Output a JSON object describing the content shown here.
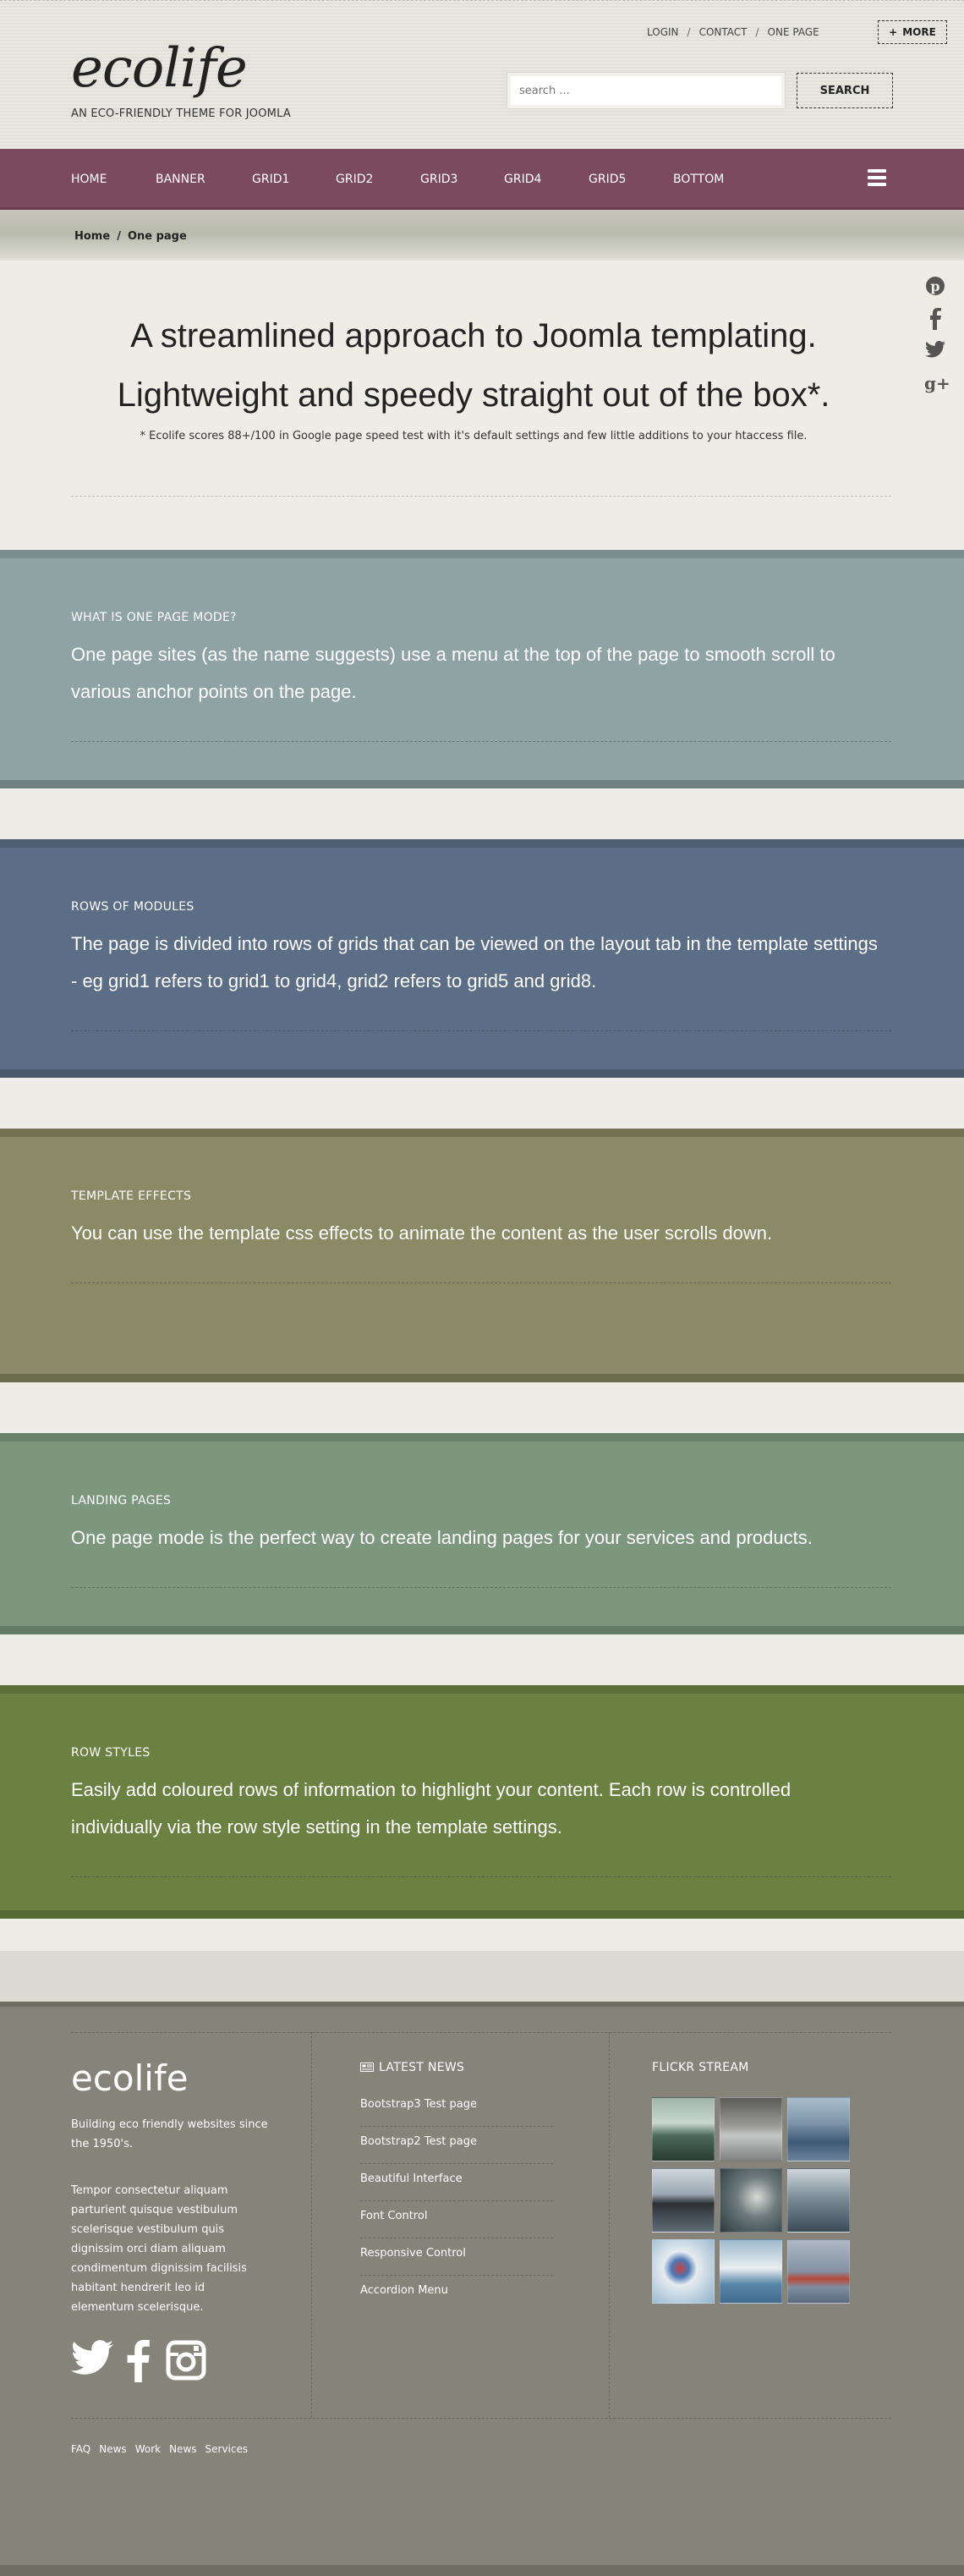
{
  "header": {
    "logo": "ecolife",
    "tagline": "AN ECO-FRIENDLY THEME FOR JOOMLA",
    "top_links": [
      "LOGIN",
      "CONTACT",
      "ONE PAGE"
    ],
    "more_label": "MORE",
    "search_placeholder": "search ...",
    "search_button": "SEARCH"
  },
  "nav": {
    "items": [
      "HOME",
      "BANNER",
      "GRID1",
      "GRID2",
      "GRID3",
      "GRID4",
      "GRID5",
      "BOTTOM"
    ],
    "color": "#7c4a5d"
  },
  "breadcrumb": [
    "Home",
    "/",
    "One page"
  ],
  "social_icons": [
    "pinterest-icon",
    "facebook-icon",
    "twitter-icon",
    "google-plus-icon"
  ],
  "hero": {
    "line1": "A streamlined approach to Joomla templating.",
    "line2": "Lightweight and speedy straight out of the box*.",
    "note": "* Ecolife scores 88+/100 in Google page speed test with it's default settings and few little additions to your htaccess file."
  },
  "rows": [
    {
      "kicker": "WHAT IS ONE PAGE MODE?",
      "line1": "One page sites (as the name suggests) use a menu at the top of the page to smooth scroll to",
      "line2": "various anchor points on the page.",
      "color": "#8fa3a5"
    },
    {
      "kicker": "ROWS OF MODULES",
      "line1": "The page is divided into rows of grids that can be viewed on the layout tab in the template settings",
      "line2": "- eg grid1 refers to grid1 to grid4, grid2 refers to grid5 and grid8.",
      "color": "#5c6e86"
    },
    {
      "kicker": "TEMPLATE EFFECTS",
      "line1": "You can use the template css effects to animate the content as the user scrolls down.",
      "line2": "",
      "color": "#8a8a66"
    },
    {
      "kicker": "LANDING PAGES",
      "line1": "One page mode is the perfect way to create landing pages for your services and products.",
      "line2": "",
      "color": "#7d977e"
    },
    {
      "kicker": "ROW STYLES",
      "line1": "Easily add coloured rows of information to highlight your content. Each row is controlled",
      "line2": "individually via the row style setting in the template settings.",
      "color": "#6b8142"
    }
  ],
  "footer": {
    "logo": "ecolife",
    "intro": [
      "Building eco friendly websites since",
      "the 1950's."
    ],
    "lorem": [
      "Tempor consectetur aliquam",
      "parturient quisque vestibulum",
      "scelerisque vestibulum quis",
      "dignissim orci diam aliquam",
      "condimentum dignissim facilisis",
      "habitant hendrerit leo id",
      "elementum scelerisque."
    ],
    "news_heading": "LATEST NEWS",
    "news": [
      "Bootstrap3 Test page",
      "Bootstrap2 Test page",
      "Beautiful Interface",
      "Font Control",
      "Responsive Control",
      "Accordion Menu"
    ],
    "flickr_heading": "FLICKR STREAM",
    "social_icons": [
      "twitter-icon",
      "facebook-icon",
      "instagram-icon"
    ],
    "links": [
      "FAQ",
      "News",
      "Work",
      "News",
      "Services"
    ]
  }
}
